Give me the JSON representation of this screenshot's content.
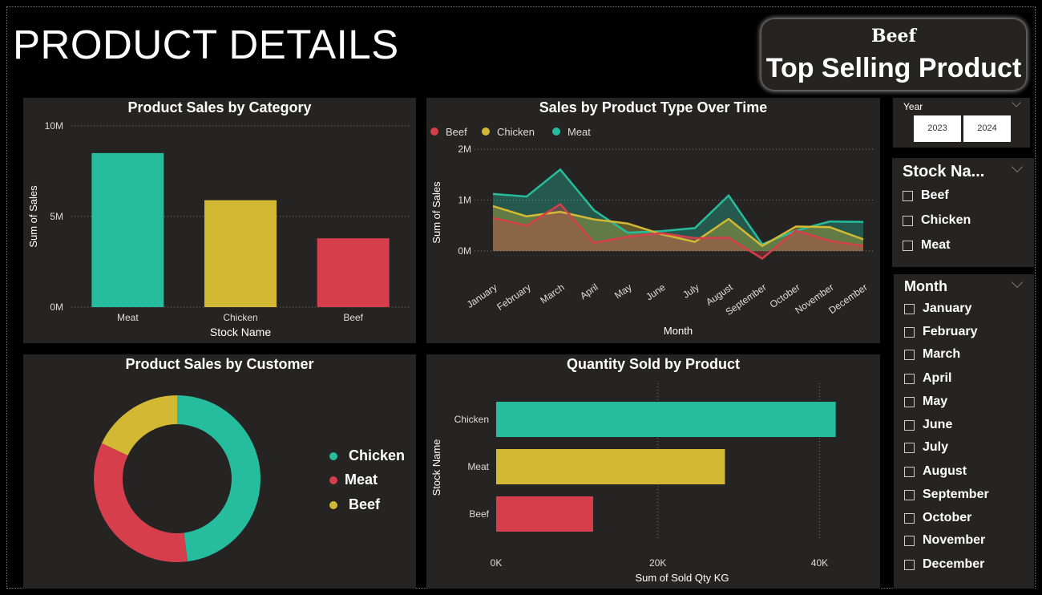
{
  "page": {
    "title": "PRODUCT DETAILS"
  },
  "kpi": {
    "value": "Beef",
    "label": "Top Selling Product"
  },
  "colors": {
    "meat": "#26BC9E",
    "chicken": "#D3B834",
    "beef": "#D63E4B",
    "panel": "#252423",
    "background": "#000000"
  },
  "panels": {
    "category": {
      "title": "Product Sales by Category"
    },
    "time": {
      "title": "Sales by Product Type Over Time"
    },
    "customer": {
      "title": "Product Sales by Customer"
    },
    "quantity": {
      "title": "Quantity Sold by Product"
    }
  },
  "slicers": {
    "year": {
      "title": "Year",
      "options": [
        "2023",
        "2024"
      ]
    },
    "stock": {
      "title": "Stock Na...",
      "options": [
        "Beef",
        "Chicken",
        "Meat"
      ]
    },
    "month": {
      "title": "Month",
      "options": [
        "January",
        "February",
        "March",
        "April",
        "May",
        "June",
        "July",
        "August",
        "September",
        "October",
        "November",
        "December"
      ]
    }
  },
  "chart_data": [
    {
      "type": "bar",
      "title": "Product Sales by Category",
      "categories": [
        "Meat",
        "Chicken",
        "Beef"
      ],
      "values": [
        8500000,
        5900000,
        3800000
      ],
      "colors": [
        "#26BC9E",
        "#D3B834",
        "#D63E4B"
      ],
      "xlabel": "Stock Name",
      "ylabel": "Sum of Sales",
      "ylim": [
        0,
        10000000
      ],
      "yticks": [
        0,
        5000000,
        10000000
      ],
      "ytick_labels": [
        "0M",
        "5M",
        "10M"
      ],
      "grid": true
    },
    {
      "type": "area",
      "title": "Sales by Product Type Over Time",
      "x": [
        "January",
        "February",
        "March",
        "April",
        "May",
        "June",
        "July",
        "August",
        "September",
        "October",
        "November",
        "December"
      ],
      "series": [
        {
          "name": "Beef",
          "color": "#D63E4B",
          "values": [
            650000,
            500000,
            920000,
            160000,
            280000,
            350000,
            250000,
            260000,
            -150000,
            400000,
            200000,
            100000
          ]
        },
        {
          "name": "Chicken",
          "color": "#D3B834",
          "values": [
            880000,
            680000,
            770000,
            620000,
            540000,
            330000,
            180000,
            630000,
            100000,
            480000,
            470000,
            230000
          ]
        },
        {
          "name": "Meat",
          "color": "#26BC9E",
          "values": [
            1120000,
            1070000,
            1600000,
            800000,
            360000,
            390000,
            450000,
            1090000,
            130000,
            400000,
            580000,
            570000
          ]
        }
      ],
      "xlabel": "Month",
      "ylabel": "Sum of Sales",
      "ylim": [
        -200000,
        2000000
      ],
      "yticks": [
        0,
        1000000,
        2000000
      ],
      "ytick_labels": [
        "0M",
        "1M",
        "2M"
      ],
      "legend": "top-left",
      "grid": true
    },
    {
      "type": "pie",
      "title": "Product Sales by Customer",
      "categories": [
        "Chicken",
        "Meat",
        "Beef"
      ],
      "values": [
        48,
        34,
        18
      ],
      "colors": [
        "#26BC9E",
        "#D63E4B",
        "#D3B834"
      ],
      "donut": true,
      "legend": "right"
    },
    {
      "type": "bar",
      "orientation": "horizontal",
      "title": "Quantity Sold by Product",
      "categories": [
        "Chicken",
        "Meat",
        "Beef"
      ],
      "values": [
        42000,
        28300,
        12000
      ],
      "colors": [
        "#26BC9E",
        "#D3B834",
        "#D63E4B"
      ],
      "xlabel": "Sum of Sold Qty KG",
      "ylabel": "Stock Name",
      "xlim": [
        0,
        46000
      ],
      "xticks": [
        0,
        20000,
        40000
      ],
      "xtick_labels": [
        "0K",
        "20K",
        "40K"
      ],
      "grid": true
    }
  ]
}
